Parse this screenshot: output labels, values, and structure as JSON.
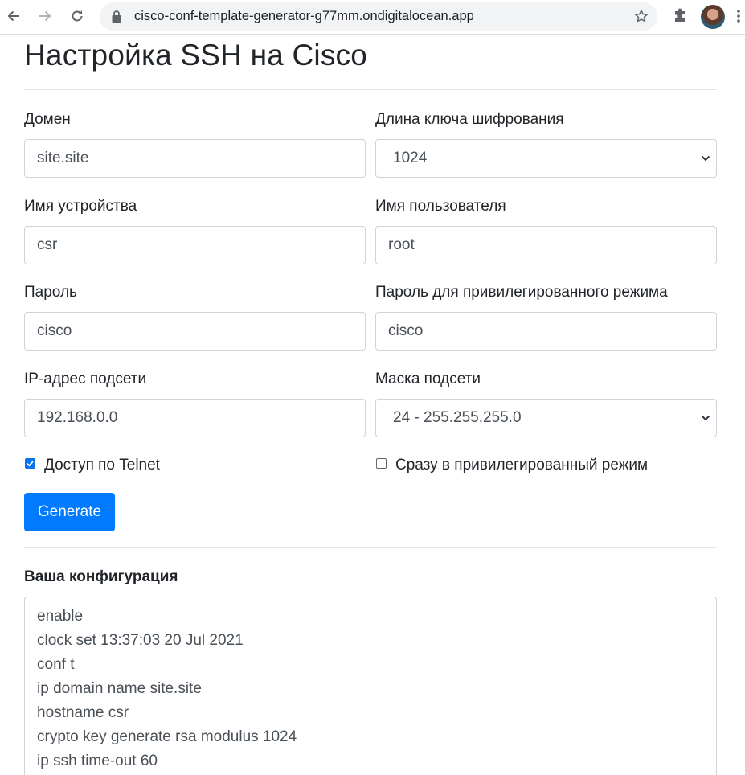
{
  "browser": {
    "url": "cisco-conf-template-generator-g77mm.ondigitalocean.app",
    "icons": [
      "back-arrow-icon",
      "forward-arrow-icon",
      "reload-icon",
      "lock-icon",
      "star-icon",
      "extensions-icon",
      "menu-dots-icon"
    ]
  },
  "page": {
    "title": "Настройка SSH на Cisco"
  },
  "form": {
    "domain": {
      "label": "Домен",
      "value": "site.site"
    },
    "key_length": {
      "label": "Длина ключа шифрования",
      "value": "1024"
    },
    "device_name": {
      "label": "Имя устройства",
      "value": "csr"
    },
    "username": {
      "label": "Имя пользователя",
      "value": "root"
    },
    "password": {
      "label": "Пароль",
      "value": "cisco"
    },
    "enable_password": {
      "label": "Пароль для привилегированного режима",
      "value": "cisco"
    },
    "subnet_ip": {
      "label": "IP-адрес подсети",
      "value": "192.168.0.0"
    },
    "subnet_mask": {
      "label": "Маска подсети",
      "value": "24 - 255.255.255.0"
    },
    "telnet": {
      "label": "Доступ по Telnet",
      "checked": true
    },
    "privileged": {
      "label": "Сразу в привилегированный режим",
      "checked": false
    },
    "generate_label": "Generate"
  },
  "output": {
    "title": "Ваша конфигурация",
    "lines": [
      "enable",
      "clock set 13:37:03 20 Jul 2021",
      "conf t",
      "ip domain name site.site",
      "hostname csr",
      "crypto key generate rsa modulus 1024",
      "ip ssh time-out 60"
    ]
  },
  "colors": {
    "primary": "#007bff",
    "checkbox": "#0b74ec",
    "input_border": "#ced4da",
    "input_text": "#495057"
  }
}
